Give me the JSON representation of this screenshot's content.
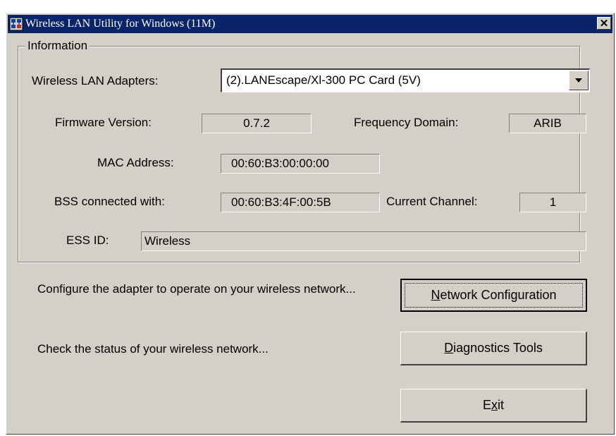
{
  "window": {
    "title": "Wireless LAN Utility for Windows (11M)",
    "close_glyph": "✕"
  },
  "information": {
    "group_label": "Information",
    "adapters_label": "Wireless LAN Adapters:",
    "adapter_selected": "(2).LANEscape/Xl-300 PC Card (5V)",
    "firmware_label": "Firmware Version:",
    "firmware_value": "0.7.2",
    "frequency_label": "Frequency Domain:",
    "frequency_value": "ARIB",
    "mac_label": "MAC Address:",
    "mac_value": "00:60:B3:00:00:00",
    "bss_label": "BSS connected with:",
    "bss_value": "00:60:B3:4F:00:5B",
    "channel_label": "Current Channel:",
    "channel_value": "1",
    "essid_label": "ESS ID:",
    "essid_value": "Wireless"
  },
  "actions": {
    "configure_text": "Configure the adapter to operate on your wireless network...",
    "network_config_mnemonic": "N",
    "network_config_rest": "etwork Configuration",
    "status_text": "Check the status of your wireless network...",
    "diagnostics_mnemonic": "D",
    "diagnostics_rest": "iagnostics Tools",
    "exit_pre": "E",
    "exit_mnemonic": "x",
    "exit_post": "it"
  },
  "icons": {
    "app": "network-app-icon",
    "dropdown": "chevron-down-icon",
    "close": "close-icon"
  }
}
